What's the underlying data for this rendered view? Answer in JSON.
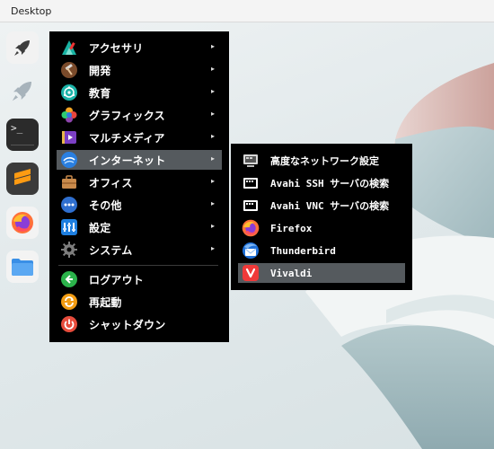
{
  "topbar": {
    "title": "Desktop"
  },
  "dock": {
    "items": [
      {
        "icon": "rocket-icon"
      },
      {
        "icon": "rocket-ghost-icon"
      },
      {
        "icon": "terminal-icon",
        "glyph": ">_"
      },
      {
        "icon": "sublime-text-icon"
      },
      {
        "icon": "firefox-icon"
      },
      {
        "icon": "folder-icon"
      }
    ]
  },
  "menu": {
    "items": [
      {
        "label": "アクセサリ",
        "icon": "accessories-icon",
        "arrow": "▸"
      },
      {
        "label": "開発",
        "icon": "hammer-icon",
        "arrow": "▸"
      },
      {
        "label": "教育",
        "icon": "education-icon",
        "arrow": "▸"
      },
      {
        "label": "グラフィックス",
        "icon": "graphics-icon",
        "arrow": "▸"
      },
      {
        "label": "マルチメディア",
        "icon": "multimedia-icon",
        "arrow": "▸"
      },
      {
        "label": "インターネット",
        "icon": "internet-icon",
        "arrow": "▸"
      },
      {
        "label": "オフィス",
        "icon": "office-icon",
        "arrow": "▸"
      },
      {
        "label": "その他",
        "icon": "other-icon",
        "arrow": "▸"
      },
      {
        "label": "設定",
        "icon": "settings-icon",
        "arrow": "▸"
      },
      {
        "label": "システム",
        "icon": "system-gear-icon",
        "arrow": "▸"
      }
    ],
    "actions": [
      {
        "label": "ログアウト",
        "icon": "logout-icon"
      },
      {
        "label": "再起動",
        "icon": "restart-icon"
      },
      {
        "label": "シャットダウン",
        "icon": "shutdown-icon"
      }
    ]
  },
  "submenu": {
    "items": [
      {
        "label": "高度なネットワーク設定",
        "icon": "network-icon"
      },
      {
        "label": "Avahi SSH サーバの検索",
        "icon": "avahi-ssh-icon"
      },
      {
        "label": "Avahi VNC サーバの検索",
        "icon": "avahi-vnc-icon"
      },
      {
        "label": "Firefox",
        "icon": "firefox-icon"
      },
      {
        "label": "Thunderbird",
        "icon": "thunderbird-icon"
      },
      {
        "label": "Vivaldi",
        "icon": "vivaldi-icon"
      }
    ]
  },
  "colors": {
    "menu_bg": "#000000",
    "active_bg": "#555a5e",
    "firefox": "#ff7139",
    "vivaldi": "#ef3939",
    "internet_blue": "#2a7fe0"
  }
}
